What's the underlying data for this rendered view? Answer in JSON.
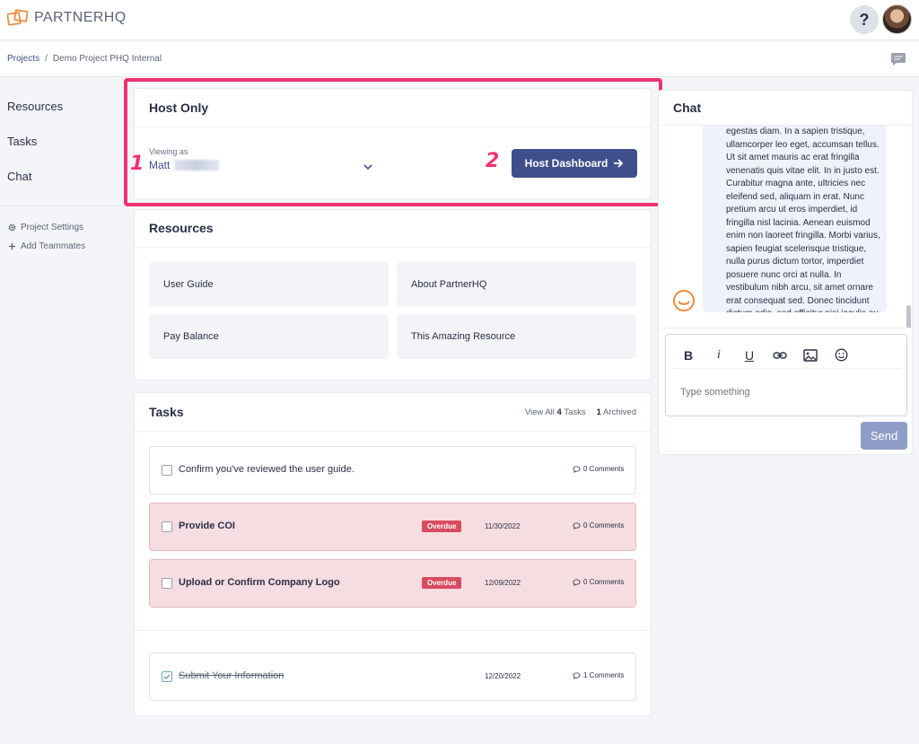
{
  "app": {
    "logo_text_light": "PARTNER",
    "logo_text_bold": "HQ",
    "help_label": "?"
  },
  "breadcrumb": {
    "root": "Projects",
    "separator": "/",
    "current": "Demo Project PHQ Internal"
  },
  "leftnav": {
    "items": [
      "Resources",
      "Tasks",
      "Chat"
    ],
    "settings": "Project Settings",
    "add_teammates": "Add Teammates"
  },
  "host_only": {
    "title": "Host Only",
    "viewing_label": "Viewing as",
    "viewing_value": "Matt",
    "dashboard_button": "Host Dashboard",
    "marker_1": "1",
    "marker_2": "2"
  },
  "resources": {
    "title": "Resources",
    "items": [
      "User Guide",
      "About PartnerHQ",
      "Pay Balance",
      "This Amazing Resource"
    ]
  },
  "tasks": {
    "title": "Tasks",
    "view_all_prefix": "View All",
    "view_all_count": "4",
    "view_all_suffix": "Tasks",
    "archived_count": "1",
    "archived_label": "Archived",
    "items": [
      {
        "label": "Confirm you've reviewed the user guide.",
        "badge": "",
        "date": "",
        "comments": "0 Comments",
        "state": "open"
      },
      {
        "label": "Provide COI",
        "badge": "Overdue",
        "date": "11/30/2022",
        "comments": "0 Comments",
        "state": "overdue"
      },
      {
        "label": "Upload or Confirm Company Logo",
        "badge": "Overdue",
        "date": "12/09/2022",
        "comments": "0 Comments",
        "state": "overdue"
      },
      {
        "label": "Submit Your Information",
        "badge": "",
        "date": "12/20/2022",
        "comments": "1 Comments",
        "state": "done"
      }
    ]
  },
  "chat": {
    "title": "Chat",
    "message": "egestas diam. In a sapien tristique, ullamcorper leo eget, accumsan tellus. Ut sit amet mauris ac erat fringilla venenatis quis vitae elit. In in justo est. Curabitur magna ante, ultricies nec eleifend sed, aliquam in erat. Nunc pretium arcu ut eros imperdiet, id fringilla nisl lacinia. Aenean euismod enim non laoreet fringilla. Morbi varius, sapien feugiat scelerisque tristique, nulla purus dictum tortor, imperdiet posuere nunc orci at nulla. In vestibulum nibh arcu, sit amet ornare erat consequat sed. Donec tincidunt dictum odio, sed efficitur nisi iaculis eu.",
    "toolbar": {
      "bold": "B",
      "italic": "i",
      "underline": "U"
    },
    "placeholder": "Type something",
    "send": "Send"
  },
  "colors": {
    "brand": "#3e4f8c",
    "highlight": "#f0326f",
    "overdue_bg": "#f5dde2",
    "overdue_badge": "#d94b60",
    "logo_orange": "#ef8a3c"
  }
}
